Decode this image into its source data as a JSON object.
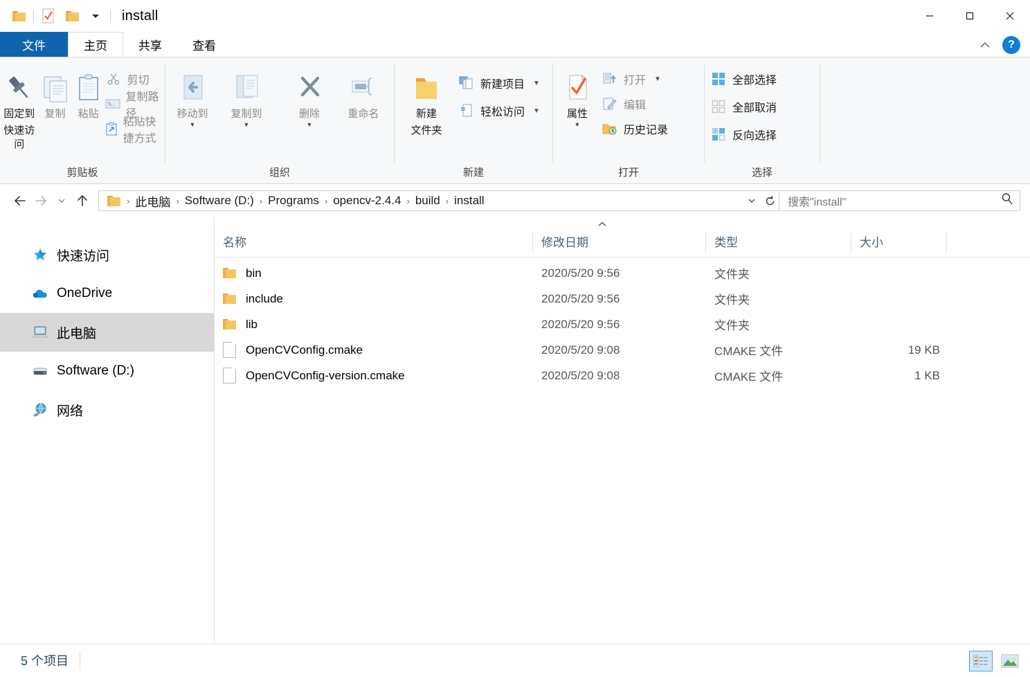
{
  "window": {
    "title": "install",
    "quick_access_icons": [
      "folder-icon",
      "properties-check-icon",
      "new-folder-icon",
      "customize-dropdown-icon"
    ],
    "controls": {
      "minimize": "—",
      "maximize": "□",
      "close": "✕"
    }
  },
  "ribbon_tabs": {
    "file": "文件",
    "home": "主页",
    "share": "共享",
    "view": "查看",
    "collapse_hint": "^",
    "help": "?"
  },
  "ribbon": {
    "groups": [
      {
        "name": "剪贴板",
        "big": [
          {
            "label_line1": "固定到",
            "label_line2": "快速访问",
            "icon": "pin-icon",
            "dim": false
          },
          {
            "label_line1": "复制",
            "label_line2": "",
            "icon": "copy-icon",
            "dim": true
          },
          {
            "label_line1": "粘贴",
            "label_line2": "",
            "icon": "paste-icon",
            "dim": true
          }
        ],
        "small": [
          {
            "label": "剪切",
            "icon": "scissors-icon",
            "dim": true
          },
          {
            "label": "复制路径",
            "icon": "copy-path-icon",
            "dim": true
          },
          {
            "label": "粘贴快捷方式",
            "icon": "paste-shortcut-icon",
            "dim": true
          }
        ]
      },
      {
        "name": "组织",
        "big": [
          {
            "label_line1": "移动到",
            "label_line2": "",
            "icon": "move-to-icon",
            "dim": true,
            "caret": true
          },
          {
            "label_line1": "复制到",
            "label_line2": "",
            "icon": "copy-to-icon",
            "dim": true,
            "caret": true
          },
          {
            "label_line1": "删除",
            "label_line2": "",
            "icon": "delete-icon",
            "dim": true,
            "caret": true
          },
          {
            "label_line1": "重命名",
            "label_line2": "",
            "icon": "rename-icon",
            "dim": true
          }
        ]
      },
      {
        "name": "新建",
        "big": [
          {
            "label_line1": "新建",
            "label_line2": "文件夹",
            "icon": "new-folder-icon",
            "dim": false
          }
        ],
        "small": [
          {
            "label": "新建项目",
            "icon": "new-item-icon",
            "dim": false,
            "caret": true
          },
          {
            "label": "轻松访问",
            "icon": "easy-access-icon",
            "dim": false,
            "caret": true
          }
        ]
      },
      {
        "name": "打开",
        "big": [
          {
            "label_line1": "属性",
            "label_line2": "",
            "icon": "properties-icon",
            "dim": false,
            "caret": true
          }
        ],
        "small": [
          {
            "label": "打开",
            "icon": "open-icon",
            "dim": true,
            "caret": true
          },
          {
            "label": "编辑",
            "icon": "edit-icon",
            "dim": true
          },
          {
            "label": "历史记录",
            "icon": "history-icon",
            "dim": false
          }
        ]
      },
      {
        "name": "选择",
        "small": [
          {
            "label": "全部选择",
            "icon": "select-all-icon",
            "dim": false
          },
          {
            "label": "全部取消",
            "icon": "select-none-icon",
            "dim": false
          },
          {
            "label": "反向选择",
            "icon": "invert-selection-icon",
            "dim": false
          }
        ]
      }
    ]
  },
  "address": {
    "back": "←",
    "forward": "→",
    "recent": "∨",
    "up": "↑",
    "crumbs": [
      "此电脑",
      "Software (D:)",
      "Programs",
      "opencv-2.4.4",
      "build",
      "install"
    ],
    "separator": "›",
    "dropdown": "∨",
    "refresh": "↻",
    "search_placeholder": "搜索\"install\""
  },
  "sidebar": {
    "items": [
      {
        "label": "快速访问",
        "icon": "star-icon",
        "selected": false
      },
      {
        "label": "OneDrive",
        "icon": "cloud-icon",
        "selected": false
      },
      {
        "label": "此电脑",
        "icon": "this-pc-icon",
        "selected": true
      },
      {
        "label": "Software (D:)",
        "icon": "drive-icon",
        "selected": false
      },
      {
        "label": "网络",
        "icon": "network-icon",
        "selected": false
      }
    ]
  },
  "filelist": {
    "columns": [
      "名称",
      "修改日期",
      "类型",
      "大小"
    ],
    "sort_indicator": "ascending",
    "rows": [
      {
        "name": "bin",
        "date": "2020/5/20 9:56",
        "type": "文件夹",
        "size": "",
        "icon": "folder-icon"
      },
      {
        "name": "include",
        "date": "2020/5/20 9:56",
        "type": "文件夹",
        "size": "",
        "icon": "folder-icon"
      },
      {
        "name": "lib",
        "date": "2020/5/20 9:56",
        "type": "文件夹",
        "size": "",
        "icon": "folder-icon"
      },
      {
        "name": "OpenCVConfig.cmake",
        "date": "2020/5/20 9:08",
        "type": "CMAKE 文件",
        "size": "19 KB",
        "icon": "file-icon"
      },
      {
        "name": "OpenCVConfig-version.cmake",
        "date": "2020/5/20 9:08",
        "type": "CMAKE 文件",
        "size": "1 KB",
        "icon": "file-icon"
      }
    ]
  },
  "status": {
    "item_count": "5 个项目",
    "views": [
      {
        "name": "details-view",
        "active": true
      },
      {
        "name": "large-icons-view",
        "active": false
      }
    ]
  },
  "colors": {
    "file_tab_blue": "#0f64ad",
    "help_blue": "#0f7fd4",
    "selection_gray": "#d8d8d8",
    "header_text": "#4a6276",
    "folder_amber": "#f6c563"
  }
}
